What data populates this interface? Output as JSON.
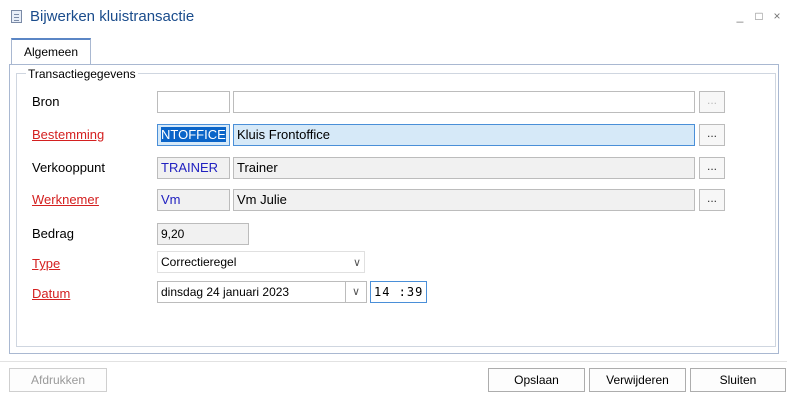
{
  "window": {
    "title": "Bijwerken kluistransactie",
    "min_glyph": "_",
    "max_glyph": "□",
    "close_glyph": "×"
  },
  "tabs": [
    {
      "label": "Algemeen",
      "active": true
    }
  ],
  "group": {
    "legend": "Transactiegegevens"
  },
  "fields": {
    "bron": {
      "label": "Bron",
      "code": "",
      "description": "",
      "browse": "..."
    },
    "bestemming": {
      "label": "Bestemming",
      "code": "NTOFFICE",
      "description": "Kluis Frontoffice",
      "browse": "..."
    },
    "verkooppunt": {
      "label": "Verkooppunt",
      "code": "TRAINER",
      "description": "Trainer",
      "browse": "..."
    },
    "werknemer": {
      "label": "Werknemer",
      "code": "Vm",
      "description": "Vm Julie",
      "browse": "..."
    },
    "bedrag": {
      "label": "Bedrag",
      "value": "9,20"
    },
    "type": {
      "label": "Type",
      "value": "Correctieregel",
      "chevron": "∨"
    },
    "datum": {
      "label": "Datum",
      "date": "dinsdag 24 januari 2023",
      "chevron": "∨",
      "time": "14 :39"
    }
  },
  "buttons": {
    "print": "Afdrukken",
    "save": "Opslaan",
    "delete": "Verwijderen",
    "close": "Sluiten"
  },
  "colors": {
    "title": "#1a4c8c",
    "required_label": "#d42020",
    "code_text": "#2020c0",
    "focus_bg": "#d6e9f8",
    "selection": "#0a64c8"
  }
}
